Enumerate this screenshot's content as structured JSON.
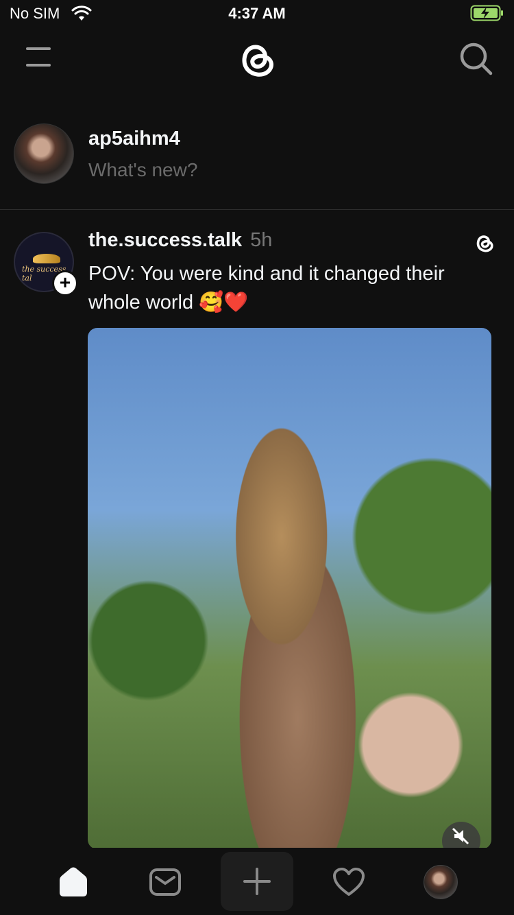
{
  "status_bar": {
    "carrier": "No SIM",
    "time": "4:37 AM",
    "battery_icon": "battery-charging-icon",
    "wifi_icon": "wifi-icon"
  },
  "top_nav": {
    "menu_icon": "menu-icon",
    "logo_icon": "threads-logo-icon",
    "search_icon": "search-icon"
  },
  "composer": {
    "username": "ap5aihm4",
    "placeholder": "What's new?"
  },
  "post": {
    "username": "the.success.talk",
    "time": "5h",
    "text": "POV: You were kind and it changed their whole world 🥰❤️",
    "avatar_lettering": "the success tal",
    "follow_badge": "+"
  },
  "tab_bar": {
    "items": [
      {
        "name": "home",
        "icon": "home-icon"
      },
      {
        "name": "inbox",
        "icon": "inbox-icon"
      },
      {
        "name": "create",
        "icon": "plus-icon"
      },
      {
        "name": "activity",
        "icon": "heart-icon"
      },
      {
        "name": "profile",
        "icon": "avatar"
      }
    ]
  },
  "colors": {
    "background": "#101010",
    "text": "#f3f5f7",
    "muted": "#777777",
    "divider": "#2d2d2d"
  }
}
